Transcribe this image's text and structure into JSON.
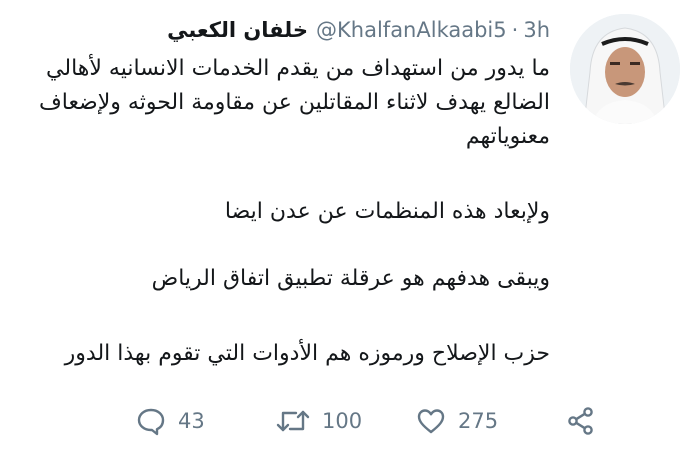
{
  "tweet": {
    "author_name": "خلفان الكعبي",
    "handle": "@KhalfanAlkaabi5",
    "separator": "·",
    "time": "3h",
    "paragraphs": [
      "ما يدور من استهداف من يقدم الخدمات الانسانيه لأهالي الضالع يهدف لاثناء المقاتلين عن مقاومة الحوثه ولإضعاف معنوياتهم",
      "ولإبعاد هذه المنظمات عن عدن ايضا",
      "ويبقى هدفهم هو عرقلة تطبيق اتفاق الرياض",
      "حزب الإصلاح ورموزه هم الأدوات التي تقوم بهذا الدور"
    ]
  },
  "actions": {
    "reply_count": "43",
    "retweet_count": "100",
    "like_count": "275"
  },
  "icons": {
    "reply": "reply-icon",
    "retweet": "retweet-icon",
    "like": "heart-icon",
    "share": "share-icon"
  },
  "colors": {
    "text": "#14171a",
    "secondary": "#657786"
  }
}
